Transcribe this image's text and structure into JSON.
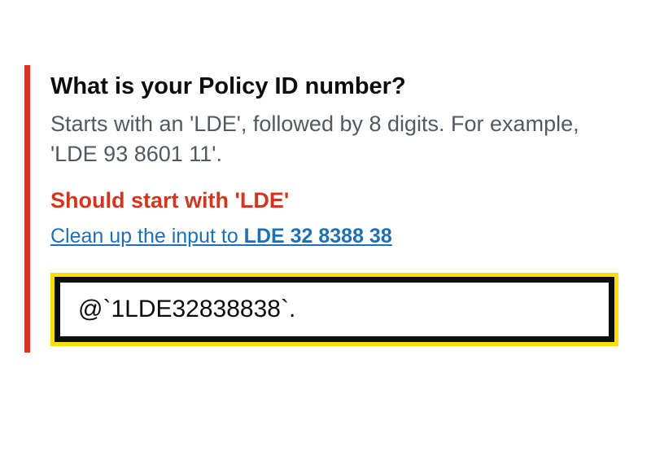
{
  "form": {
    "question": "What is your Policy ID number?",
    "hint": "Starts with an 'LDE', followed by 8 digits. For example, 'LDE 93 8601 11'.",
    "error": "Should start with 'LDE'",
    "cleanup_prefix": "Clean up the input to ",
    "cleanup_suggestion": "LDE 32 8388 38",
    "input_value": "@`1LDE32838838`."
  }
}
